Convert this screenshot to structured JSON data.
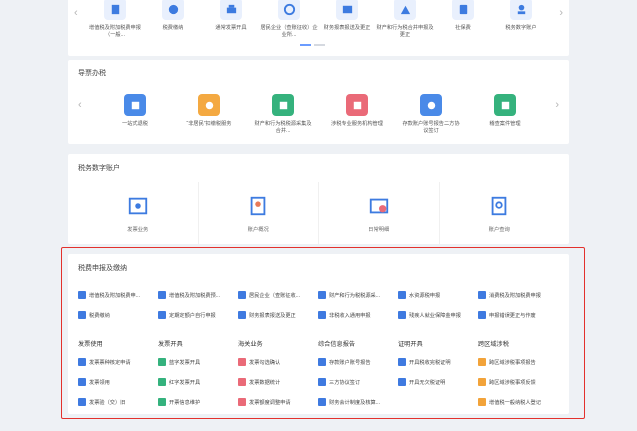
{
  "top_services": {
    "items": [
      {
        "label": "增值税及附加税费申报（一般...",
        "icon": "document-icon",
        "color": "#3d7be0"
      },
      {
        "label": "税费缴纳",
        "icon": "tax-icon",
        "color": "#3d7be0"
      },
      {
        "label": "通常发票开具",
        "icon": "printer-icon",
        "color": "#3d7be0"
      },
      {
        "label": "居民企业（查账征收）企业所...",
        "icon": "enterprise-icon",
        "color": "#3d7be0"
      },
      {
        "label": "财务报表报送及更正",
        "icon": "report-icon",
        "color": "#3d7be0"
      },
      {
        "label": "财产和行为税合并申报及更正",
        "icon": "property-icon",
        "color": "#3d7be0"
      },
      {
        "label": "社保费",
        "icon": "social-icon",
        "color": "#3d7be0"
      },
      {
        "label": "税务数字账户",
        "icon": "account-icon",
        "color": "#3d7be0"
      }
    ]
  },
  "hot_tasks": {
    "title": "导票办税",
    "items": [
      {
        "label": "一站式退税",
        "icon": "refund-icon",
        "color": "#4a8ae8"
      },
      {
        "label": "“非居民”扣缴税服务",
        "icon": "service-icon",
        "color": "#f4a941"
      },
      {
        "label": "财产和行为税税源采集及合并...",
        "icon": "collect-icon",
        "color": "#35b27d"
      },
      {
        "label": "涉税专业服务机构管理",
        "icon": "agency-icon",
        "color": "#ea6a78"
      },
      {
        "label": "存款账户账号报告二方协议签订",
        "icon": "bank-icon",
        "color": "#4a8ae8"
      },
      {
        "label": "稽查案件管理",
        "icon": "case-icon",
        "color": "#35b27d"
      }
    ]
  },
  "tax_account": {
    "title": "税务数字账户",
    "items": [
      {
        "label": "发票业务",
        "icon": "invoice-icon"
      },
      {
        "label": "账户概况",
        "icon": "profile-icon"
      },
      {
        "label": "日常明细",
        "icon": "detail-icon"
      },
      {
        "label": "账户查询",
        "icon": "query-icon"
      }
    ]
  },
  "tax_declaration": {
    "title": "税费申报及缴纳",
    "items": [
      {
        "label": "增值税及附加税费申...",
        "color": "#3f7ae0"
      },
      {
        "label": "增值税及附加税费预...",
        "color": "#3f7ae0"
      },
      {
        "label": "居民企业（查账征收...",
        "color": "#3f7ae0"
      },
      {
        "label": "财产和行为税税源采...",
        "color": "#3f7ae0"
      },
      {
        "label": "水资源税申报",
        "color": "#3f7ae0"
      },
      {
        "label": "消费税及附加税费申报",
        "color": "#3f7ae0"
      },
      {
        "label": "税费缴纳",
        "color": "#3f7ae0"
      },
      {
        "label": "定期定额户自行申报",
        "color": "#3f7ae0"
      },
      {
        "label": "财务报表报送及更正",
        "color": "#3f7ae0"
      },
      {
        "label": "非税收入通用申报",
        "color": "#3f7ae0"
      },
      {
        "label": "残疾人就业保障金申报",
        "color": "#3f7ae0"
      },
      {
        "label": "申报错误更正与作废",
        "color": "#3f7ae0"
      }
    ]
  },
  "categories": [
    {
      "head": "发票使用",
      "items": [
        {
          "label": "发票票种核定申请",
          "color": "#3f7ae0"
        },
        {
          "label": "发票领用",
          "color": "#3f7ae0"
        },
        {
          "label": "发票验（交）旧",
          "color": "#3f7ae0"
        }
      ]
    },
    {
      "head": "发票开具",
      "items": [
        {
          "label": "蓝字发票开具",
          "color": "#34b27d"
        },
        {
          "label": "红字发票开具",
          "color": "#34b27d"
        },
        {
          "label": "开票信息维护",
          "color": "#34b27d"
        }
      ]
    },
    {
      "head": "海关业务",
      "items": [
        {
          "label": "发票勾选确认",
          "color": "#ea6a78"
        },
        {
          "label": "发票数据统计",
          "color": "#ea6a78"
        },
        {
          "label": "发票额度调整申请",
          "color": "#ea6a78"
        }
      ]
    },
    {
      "head": "综合信息报告",
      "items": [
        {
          "label": "存款账户账号报告",
          "color": "#3f7ae0"
        },
        {
          "label": "三方协议签订",
          "color": "#3f7ae0"
        },
        {
          "label": "财务会计制度及核算...",
          "color": "#3f7ae0"
        }
      ]
    },
    {
      "head": "证明开具",
      "items": [
        {
          "label": "开具税收完税证明",
          "color": "#3f7ae0"
        },
        {
          "label": "开具无欠税证明",
          "color": "#3f7ae0"
        }
      ]
    },
    {
      "head": "跨区域涉税",
      "items": [
        {
          "label": "跨区域涉税事项报告",
          "color": "#f2a33a"
        },
        {
          "label": "跨区域涉税事项反馈",
          "color": "#f2a33a"
        },
        {
          "label": "增值税一般纳税人登记",
          "color": "#f2a33a"
        }
      ]
    }
  ]
}
